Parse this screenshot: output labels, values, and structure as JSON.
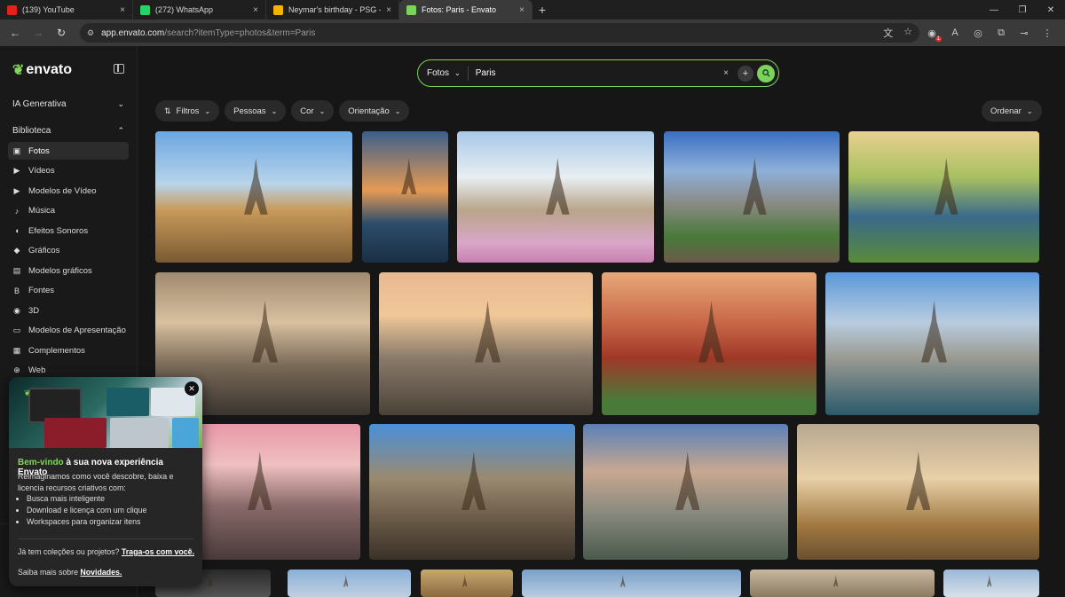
{
  "browser": {
    "tabs": [
      {
        "label": "(139) YouTube",
        "color": "#e62117",
        "active": false
      },
      {
        "label": "(272) WhatsApp",
        "color": "#25d366",
        "active": false
      },
      {
        "label": "Neymar's birthday - PSG - Goo",
        "color": "#f4b400",
        "active": false
      },
      {
        "label": "Fotos: Paris - Envato",
        "color": "#7cd35a",
        "active": true
      }
    ],
    "close_glyph": "×",
    "new_tab_glyph": "+",
    "url_host": "app.envato.com",
    "url_path": "/search?itemType=photos&term=Paris",
    "ext_badge": "1"
  },
  "sidebar": {
    "logo": "envato",
    "sections": [
      {
        "label": "IA Generativa",
        "chevron": "⌄"
      },
      {
        "label": "Biblioteca",
        "chevron": "⌃"
      }
    ],
    "items": [
      {
        "label": "Fotos",
        "icon": "image-icon",
        "glyph": "▣",
        "active": true
      },
      {
        "label": "Vídeos",
        "icon": "video-icon",
        "glyph": "▶",
        "active": false
      },
      {
        "label": "Modelos de Vídeo",
        "icon": "video-template-icon",
        "glyph": "▶",
        "active": false
      },
      {
        "label": "Música",
        "icon": "music-icon",
        "glyph": "♪",
        "active": false
      },
      {
        "label": "Efeitos Sonoros",
        "icon": "sound-effects-icon",
        "glyph": "◖",
        "active": false
      },
      {
        "label": "Gráficos",
        "icon": "graphics-icon",
        "glyph": "◆",
        "active": false
      },
      {
        "label": "Modelos gráficos",
        "icon": "graphic-templates-icon",
        "glyph": "▤",
        "active": false
      },
      {
        "label": "Fontes",
        "icon": "fonts-icon",
        "glyph": "B",
        "active": false
      },
      {
        "label": "3D",
        "icon": "3d-icon",
        "glyph": "◉",
        "active": false
      },
      {
        "label": "Modelos de Apresentação",
        "icon": "presentation-icon",
        "glyph": "▭",
        "active": false
      },
      {
        "label": "Complementos",
        "icon": "addons-icon",
        "glyph": "▦",
        "active": false
      },
      {
        "label": "Web",
        "icon": "web-icon",
        "glyph": "⊕",
        "active": false
      }
    ]
  },
  "search": {
    "type_label": "Fotos",
    "term": "Paris",
    "clear_glyph": "×",
    "add_glyph": "+"
  },
  "filters": [
    {
      "label": "Filtros",
      "icon": "sliders-icon"
    },
    {
      "label": "Pessoas"
    },
    {
      "label": "Cor"
    },
    {
      "label": "Orientação"
    }
  ],
  "sort_label": "Ordenar",
  "promo": {
    "title_highlight": "Bem-vindo",
    "title_rest": " à sua nova experiência Envato",
    "body": "Reimaginamos como você descobre, baixa e licencia recursos criativos com:",
    "bullets": [
      "Busca mais inteligente",
      "Download e licença com um clique",
      "Workspaces para organizar itens"
    ],
    "question": "Já tem coleções ou projetos? ",
    "question_link": "Traga-os com você.",
    "more": "Saiba mais sobre ",
    "more_link": "Novidades."
  },
  "photos": [
    {
      "bg": "linear-gradient(180deg,#6aa6e0 0%,#b8d4ea 40%,#c89a5a 60%,#7a5a32 100%)"
    },
    {
      "bg": "linear-gradient(180deg,#3b5f8c 0%,#e59a54 45%,#2d4d6b 70%,#1a2f44 100%)"
    },
    {
      "bg": "linear-gradient(180deg,#a8c8e8 0%,#e8eef2 35%,#b9a58a 60%,#d9a6c8 85%,#c880b0 100%)"
    },
    {
      "bg": "linear-gradient(180deg,#3a6ec2 0%,#8eb0d8 30%,#8a8a84 55%,#4a7a3a 80%,#6a5a4a 100%)"
    },
    {
      "bg": "linear-gradient(180deg,#e8d090 0%,#a8c060 35%,#3a6a8a 65%,#5a8a3a 100%)"
    },
    {
      "bg": "linear-gradient(180deg,#a08a70 0%,#d8c0a0 35%,#7a6a58 65%,#3a3530 100%)"
    },
    {
      "bg": "linear-gradient(180deg,#e8b890 0%,#f0c898 30%,#8a7a6a 60%,#4a4238 100%)"
    },
    {
      "bg": "linear-gradient(180deg,#e8a878 0%,#c86848 35%,#a03828 60%,#4a7a3a 90%)"
    },
    {
      "bg": "linear-gradient(180deg,#5a98d8 0%,#b8cce0 35%,#9a9a92 60%,#2a5a6a 100%)"
    },
    {
      "bg": "linear-gradient(180deg,#e898a8 0%,#f0c0c0 30%,#8a6a6a 60%,#4a3a3a 100%)"
    },
    {
      "bg": "linear-gradient(180deg,#4a90d8 0%,#9a8a70 40%,#6a5a48 70%,#3a3228 100%)"
    },
    {
      "bg": "linear-gradient(180deg,#5a80b8 0%,#c8a890 35%,#8a8a80 65%,#4a5a4a 100%)"
    },
    {
      "bg": "linear-gradient(180deg,#b8a890 0%,#e8d0a8 40%,#a07840 75%,#6a5030 100%)"
    },
    {
      "bg": "linear-gradient(180deg,#2a2a2a 0%,#555 100%)"
    },
    {
      "bg": "linear-gradient(180deg,#8ab0d8 0%,#c0d0e0 100%)"
    },
    {
      "bg": "linear-gradient(180deg,#c8a870 0%,#8a6a40 100%)"
    },
    {
      "bg": "linear-gradient(180deg,#7aa0c8 0%,#b8cce0 100%)"
    },
    {
      "bg": "linear-gradient(180deg,#c8b8a0 0%,#8a7a60 100%)"
    },
    {
      "bg": "linear-gradient(180deg,#9ab8d8 0%,#d8e0e8 100%)"
    }
  ]
}
